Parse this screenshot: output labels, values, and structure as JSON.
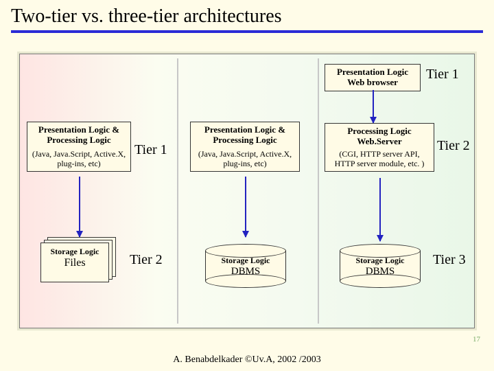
{
  "title": "Two-tier vs. three-tier architectures",
  "col_left": {
    "top_box_title": "Presentation Logic & Processing Logic",
    "top_box_sub": "(Java, Java.Script, Active.X, plug-ins, etc)",
    "tier_label": "Tier 1",
    "storage_title": "Storage Logic",
    "storage_main": "Files",
    "tier2_label": "Tier 2"
  },
  "col_mid": {
    "top_box_title": "Presentation Logic & Processing Logic",
    "top_box_sub": "(Java, Java.Script, Active.X, plug-ins, etc)",
    "storage_title": "Storage Logic",
    "storage_main": "DBMS"
  },
  "col_right": {
    "pres_title": "Presentation Logic",
    "pres_sub": "Web browser",
    "tier1_label": "Tier 1",
    "proc_title": "Processing Logic Web.Server",
    "proc_sub": "(CGI, HTTP server API, HTTP server module, etc. )",
    "tier2_label": "Tier 2",
    "storage_title": "Storage Logic",
    "storage_main": "DBMS",
    "tier3_label": "Tier 3"
  },
  "footer": "A. Benabdelkader ©Uv.A, 2002 /2003",
  "page_number": "17"
}
